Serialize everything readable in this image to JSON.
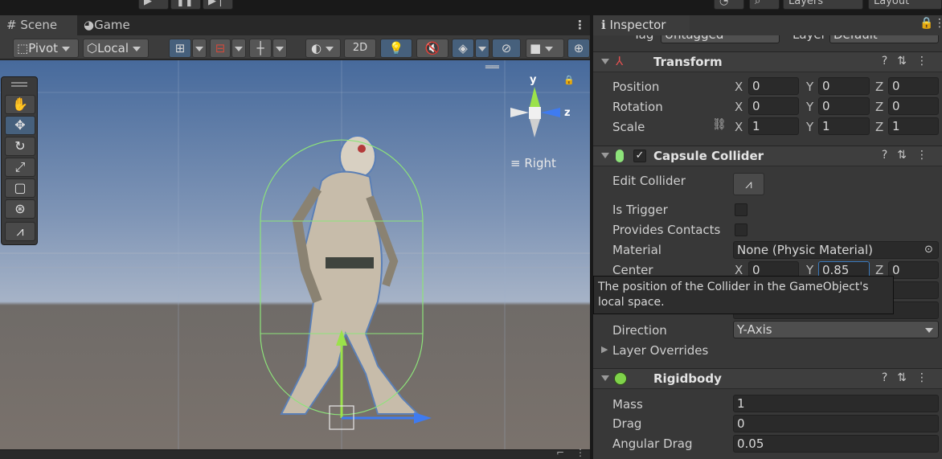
{
  "scene_tabs": {
    "scene": "Scene",
    "game": "Game"
  },
  "topbar": {
    "layers": "Layers",
    "layout": "Layout"
  },
  "scene_toolbar": {
    "pivot": "Pivot",
    "local": "Local",
    "mode_2d": "2D"
  },
  "gizmo": {
    "y_label": "y",
    "z_label": "z",
    "view_label": "Right"
  },
  "inspector": {
    "tab": "Inspector",
    "tag_label": "Tag",
    "tag_value": "Untagged",
    "layer_label": "Layer",
    "layer_value": "Default",
    "transform": {
      "title": "Transform",
      "position_label": "Position",
      "rotation_label": "Rotation",
      "scale_label": "Scale",
      "axis_x": "X",
      "axis_y": "Y",
      "axis_z": "Z",
      "position": {
        "x": "0",
        "y": "0",
        "z": "0"
      },
      "rotation": {
        "x": "0",
        "y": "0",
        "z": "0"
      },
      "scale": {
        "x": "1",
        "y": "1",
        "z": "1"
      }
    },
    "capsule": {
      "title": "Capsule Collider",
      "edit_collider": "Edit Collider",
      "is_trigger": "Is Trigger",
      "provides_contacts": "Provides Contacts",
      "material_label": "Material",
      "material_value": "None (Physic Material)",
      "center_label": "Center",
      "center": {
        "x": "0",
        "y": "0.85",
        "z": "0"
      },
      "direction_label": "Direction",
      "direction_value": "Y-Axis",
      "layer_overrides": "Layer Overrides"
    },
    "rigidbody": {
      "title": "Rigidbody",
      "mass_label": "Mass",
      "mass": "1",
      "drag_label": "Drag",
      "drag": "0",
      "angular_drag_label": "Angular Drag",
      "angular_drag": "0.05"
    },
    "tooltip": "The position of the Collider in the GameObject's local space."
  },
  "colors": {
    "accent": "#46607c",
    "collider": "#8de37a",
    "axis_y": "#9be24a",
    "axis_z": "#3f7bf0"
  }
}
